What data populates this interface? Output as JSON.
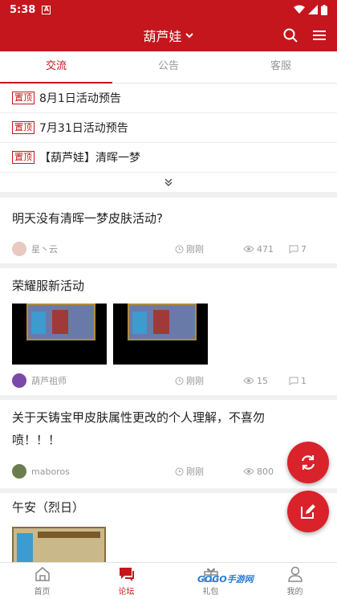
{
  "status_bar": {
    "time": "5:38",
    "notif_glyph": "A"
  },
  "app_bar": {
    "title": "葫芦娃"
  },
  "tabs": [
    {
      "label": "交流",
      "active": true
    },
    {
      "label": "公告",
      "active": false
    },
    {
      "label": "客服",
      "active": false
    }
  ],
  "pinned": {
    "tag": "置顶",
    "items": [
      {
        "title": "8月1日活动预告"
      },
      {
        "title": "7月31日活动预告"
      },
      {
        "title": "【葫芦娃】清晖一梦"
      }
    ]
  },
  "posts": [
    {
      "title": "明天没有清晖一梦皮肤活动?",
      "author": "星丶云",
      "time": "刚刚",
      "views": "471",
      "comments": "7"
    },
    {
      "title": "荣耀服新活动",
      "author": "葫芦祖师",
      "time": "刚刚",
      "views": "15",
      "comments": "1"
    },
    {
      "title_line1": "关于天铸宝甲皮肤属性更改的个人理解，不喜勿",
      "title_line2": "喷！！！",
      "author": "maboros",
      "time": "刚刚",
      "views": "800"
    },
    {
      "title": "午安（烈日）"
    }
  ],
  "bottom_nav": [
    {
      "label": "首页",
      "icon": "home-icon"
    },
    {
      "label": "论坛",
      "icon": "forum-icon",
      "active": true
    },
    {
      "label": "礼包",
      "icon": "gift-icon"
    },
    {
      "label": "我的",
      "icon": "user-icon"
    }
  ],
  "watermark": "GOGO手游网",
  "colors": {
    "brand": "#c4161c",
    "fab": "#d9222a"
  }
}
